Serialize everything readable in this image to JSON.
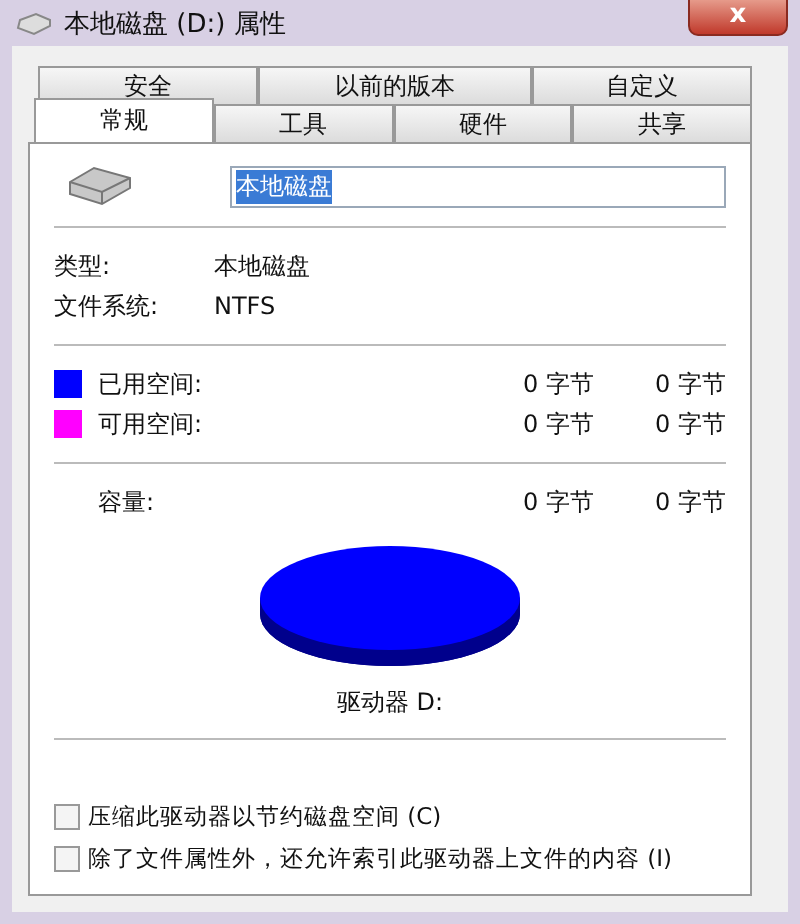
{
  "window": {
    "title": "本地磁盘 (D:) 属性",
    "close": "x"
  },
  "tabs": {
    "back_row": [
      {
        "label": "安全",
        "selected": false
      },
      {
        "label": "以前的版本",
        "selected": false
      },
      {
        "label": "自定义",
        "selected": false
      }
    ],
    "front_row": [
      {
        "label": "常规",
        "selected": true
      },
      {
        "label": "工具",
        "selected": false
      },
      {
        "label": "硬件",
        "selected": false
      },
      {
        "label": "共享",
        "selected": false
      }
    ]
  },
  "drive_name": {
    "value": "本地磁盘"
  },
  "info": [
    {
      "label": "类型:",
      "value": "本地磁盘"
    },
    {
      "label": "文件系统:",
      "value": "NTFS"
    }
  ],
  "space": [
    {
      "label": "已用空间:",
      "bytes": "0 字节",
      "size": "0 字节",
      "color": "#0000ff"
    },
    {
      "label": "可用空间:",
      "bytes": "0 字节",
      "size": "0 字节",
      "color": "#ff00ff"
    }
  ],
  "capacity": {
    "label": "容量:",
    "bytes": "0 字节",
    "size": "0 字节"
  },
  "drive_label": "驱动器 D:",
  "options": [
    {
      "label": "压缩此驱动器以节约磁盘空间 (C)",
      "checked": false
    },
    {
      "label": "除了文件属性外，还允许索引此驱动器上文件的内容 (I)",
      "checked": false
    }
  ]
}
